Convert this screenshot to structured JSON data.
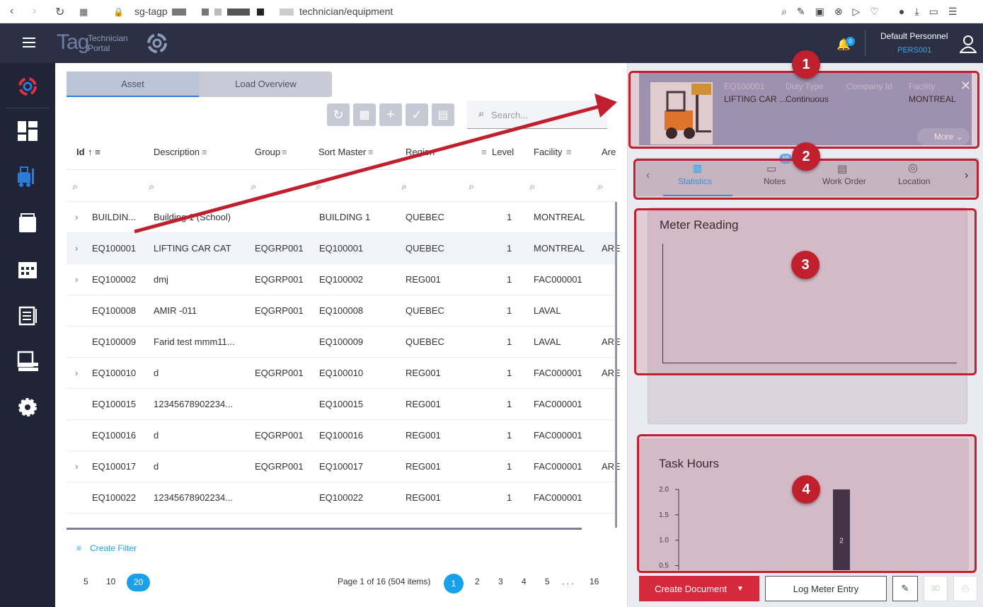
{
  "browser": {
    "url_prefix": "sg-tagp",
    "url_suffix": "technician/equipment"
  },
  "app": {
    "logo_main": "Tag",
    "logo_sub1": "Technician",
    "logo_sub2": "Portal",
    "notification_count": "0",
    "user_name": "Default Personnel",
    "user_id": "PERS001"
  },
  "tabs": {
    "asset": "Asset",
    "load_overview": "Load Overview"
  },
  "search": {
    "placeholder": "Search..."
  },
  "table": {
    "columns": [
      "Id",
      "Description",
      "Group",
      "Sort Master",
      "Region",
      "Level",
      "Facility",
      "Are"
    ],
    "rows": [
      {
        "id": "BUILDIN...",
        "desc": "Building 1 (School)",
        "group": "",
        "sort": "BUILDING 1",
        "region": "QUEBEC",
        "level": "1",
        "facility": "MONTREAL",
        "area": "",
        "expand": true
      },
      {
        "id": "EQ100001",
        "desc": "LIFTING CAR CAT",
        "group": "EQGRP001",
        "sort": "EQ100001",
        "region": "QUEBEC",
        "level": "1",
        "facility": "MONTREAL",
        "area": "ARE",
        "expand": true
      },
      {
        "id": "EQ100002",
        "desc": "dmj",
        "group": "EQGRP001",
        "sort": "EQ100002",
        "region": "REG001",
        "level": "1",
        "facility": "FAC000001",
        "area": "",
        "expand": true
      },
      {
        "id": "EQ100008",
        "desc": "AMIR -011",
        "group": "EQGRP001",
        "sort": "EQ100008",
        "region": "QUEBEC",
        "level": "1",
        "facility": "LAVAL",
        "area": "",
        "expand": false
      },
      {
        "id": "EQ100009",
        "desc": "Farid test mmm11...",
        "group": "",
        "sort": "EQ100009",
        "region": "QUEBEC",
        "level": "1",
        "facility": "LAVAL",
        "area": "ARE",
        "expand": false
      },
      {
        "id": "EQ100010",
        "desc": "d",
        "group": "EQGRP001",
        "sort": "EQ100010",
        "region": "REG001",
        "level": "1",
        "facility": "FAC000001",
        "area": "ARE",
        "expand": true
      },
      {
        "id": "EQ100015",
        "desc": "12345678902234...",
        "group": "",
        "sort": "EQ100015",
        "region": "REG001",
        "level": "1",
        "facility": "FAC000001",
        "area": "",
        "expand": false
      },
      {
        "id": "EQ100016",
        "desc": "d",
        "group": "EQGRP001",
        "sort": "EQ100016",
        "region": "REG001",
        "level": "1",
        "facility": "FAC000001",
        "area": "",
        "expand": false
      },
      {
        "id": "EQ100017",
        "desc": "d",
        "group": "EQGRP001",
        "sort": "EQ100017",
        "region": "REG001",
        "level": "1",
        "facility": "FAC000001",
        "area": "ARE",
        "expand": true
      },
      {
        "id": "EQ100022",
        "desc": "12345678902234...",
        "group": "",
        "sort": "EQ100022",
        "region": "REG001",
        "level": "1",
        "facility": "FAC000001",
        "area": "",
        "expand": false
      }
    ]
  },
  "filter": {
    "create_label": "Create Filter"
  },
  "pager": {
    "sizes": [
      "5",
      "10",
      "20"
    ],
    "active_size": "20",
    "info": "Page 1 of 16 (504 items)",
    "pages": [
      "1",
      "2",
      "3",
      "4",
      "5",
      ". . .",
      "16"
    ],
    "active_page": "1"
  },
  "detail": {
    "id_label": "EQ100001",
    "name": "LIFTING CAR ...",
    "duty_type_label": "Duty Type",
    "duty_type": "Continuous",
    "company_label": "Company Id",
    "facility_label": "Facility",
    "facility": "MONTREAL",
    "more": "More",
    "tabs": [
      "Statistics",
      "Notes",
      "Work Order",
      "Location"
    ],
    "notes_badge": "10",
    "meter_title": "Meter Reading",
    "task_title": "Task Hours"
  },
  "chart_data": {
    "type": "bar",
    "title": "Task Hours",
    "yticks": [
      "2.0",
      "1.5",
      "1.0",
      "0.5"
    ],
    "series": [
      {
        "values": [
          2
        ]
      }
    ],
    "data_labels": [
      "2"
    ]
  },
  "actions": {
    "create_document": "Create Document",
    "log_meter": "Log Meter Entry"
  },
  "annotations": [
    "1",
    "2",
    "3",
    "4"
  ],
  "colors": {
    "appbar": "#2b3044",
    "sidebar": "#1f2436",
    "accent": "#1aa0e8",
    "annotation": "#c0202e",
    "create_btn": "#d42a3c"
  }
}
